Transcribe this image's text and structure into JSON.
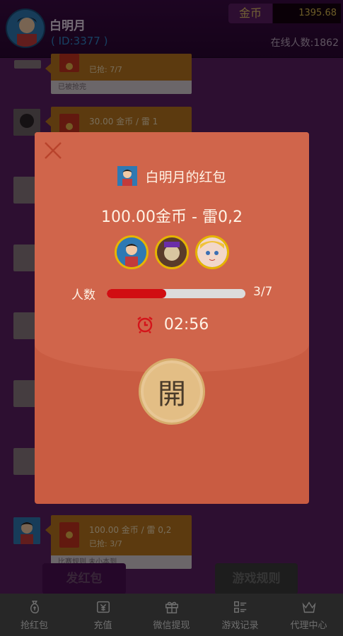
{
  "header": {
    "user_name": "白明月",
    "user_id": "( ID:3377 )",
    "coin_label": "金币",
    "coin_value": "1395.68",
    "online_text": "在线人数:1862"
  },
  "chat": {
    "messages": [
      {
        "line1": "",
        "line2": "已抢: 7/7",
        "footer": "已被抢完"
      },
      {
        "line1": "30.00 金币 / 雷 1",
        "line2": "",
        "footer": ""
      },
      {
        "line1": "100.00 金币 / 雷 0,2",
        "line2": "已抢: 3/7",
        "footer": "比赛规则 未小本到"
      }
    ]
  },
  "actions": {
    "send_label": "发红包",
    "rules_label": "游戏规则"
  },
  "tabbar": {
    "items": [
      {
        "label": "抢红包",
        "icon": "money-bag-icon"
      },
      {
        "label": "充值",
        "icon": "yen-ticket-icon"
      },
      {
        "label": "微信提现",
        "icon": "gift-icon"
      },
      {
        "label": "游戏记录",
        "icon": "list-icon"
      },
      {
        "label": "代理中心",
        "icon": "crown-icon"
      }
    ]
  },
  "popup": {
    "title": "白明月的红包",
    "amount": "100.00金币 - 雷0,2",
    "grabbed_label": "人数",
    "grabbed_count": "3/7",
    "grabbed_fraction": 0.43,
    "timer": "02:56",
    "open_label": "開",
    "colors": {
      "accent": "#d10e12",
      "panel": "#c95c42",
      "gold": "#e3be85"
    }
  }
}
